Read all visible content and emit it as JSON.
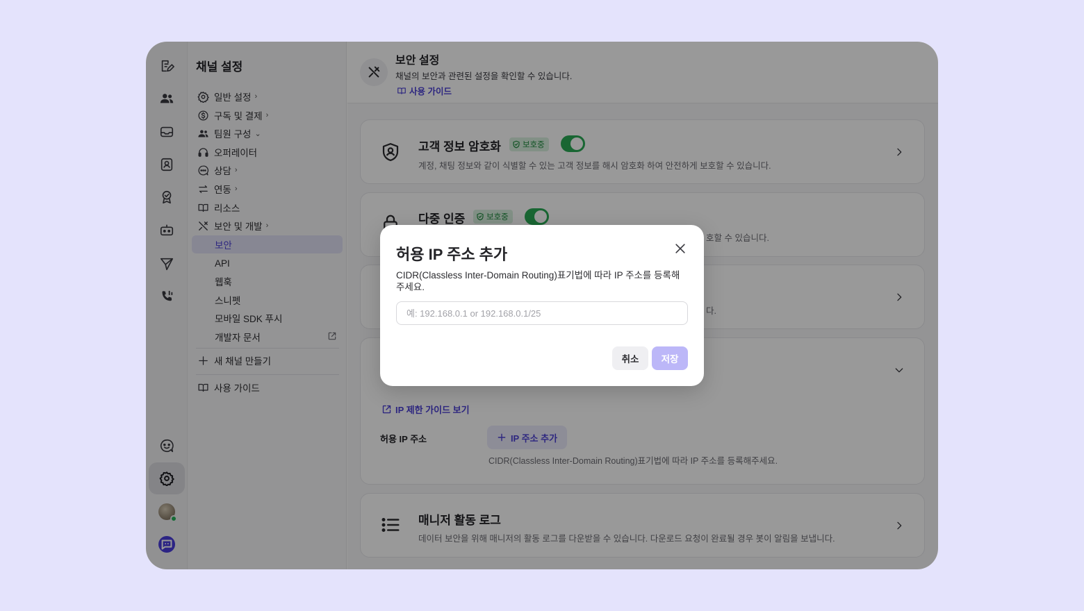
{
  "colors": {
    "accent": "#4c40d6",
    "success": "#2aaa55",
    "save_disabled": "#bcb7f8"
  },
  "rail": {
    "icons": [
      "compose-icon",
      "users-icon",
      "inbox-icon",
      "contacts-icon",
      "badge-icon",
      "bot-icon",
      "send-icon",
      "phone-icon",
      "feedback-icon",
      "gear-icon",
      "avatar",
      "brand-icon"
    ]
  },
  "sidebar": {
    "title": "채널 설정",
    "items": [
      {
        "label": "일반 설정",
        "icon": "gear-icon",
        "chevron": ">"
      },
      {
        "label": "구독 및 결제",
        "icon": "dollar-icon",
        "chevron": ">"
      },
      {
        "label": "팀원 구성",
        "icon": "team-icon",
        "chevron": "v"
      },
      {
        "label": "오퍼레이터",
        "icon": "headset-icon"
      },
      {
        "label": "상담",
        "icon": "chat-icon",
        "chevron": ">"
      },
      {
        "label": "연동",
        "icon": "swap-icon",
        "chevron": ">"
      },
      {
        "label": "리소스",
        "icon": "book-icon"
      },
      {
        "label": "보안 및 개발",
        "icon": "tools-icon",
        "chevron": ">"
      }
    ],
    "sub_items": [
      "보안",
      "API",
      "웹훅",
      "스니펫",
      "모바일 SDK 푸시",
      "개발자 문서"
    ],
    "new_channel": "새 채널 만들기",
    "guide": "사용 가이드"
  },
  "header": {
    "title": "보안 설정",
    "description": "채널의 보안과 관련된 설정을 확인할 수 있습니다.",
    "guide_link": "사용 가이드"
  },
  "cards": {
    "encryption": {
      "title": "고객 정보 암호화",
      "badge": "보호중",
      "toggle_on": true,
      "description": "계정, 채팅 정보와 같이 식별할 수 있는 고객 정보를 해시 암호화 하여 안전하게 보호할 수 있습니다."
    },
    "mfa": {
      "title": "다중 인증",
      "badge": "보호중",
      "toggle_on": true,
      "description_tail": "호할 수 있습니다."
    },
    "card3": {
      "description_tail": "다."
    },
    "ip": {
      "guide_link": "IP 제한 가이드 보기",
      "label": "허용 IP 주소",
      "add_button": "IP 주소 추가",
      "help": "CIDR(Classless Inter-Domain Routing)표기법에 따라 IP 주소를 등록해주세요."
    },
    "activity": {
      "title": "매니저 활동 로그",
      "description": "데이터 보안을 위해 매니저의 활동 로그를 다운받을 수 있습니다. 다운로드 요청이 완료될 경우 봇이 알림을 보냅니다."
    }
  },
  "modal": {
    "title": "허용 IP 주소 추가",
    "description": "CIDR(Classless Inter-Domain Routing)표기법에 따라 IP 주소를 등록해주세요.",
    "input_value": "",
    "input_placeholder": "예: 192.168.0.1 or 192.168.0.1/25",
    "cancel": "취소",
    "save": "저장"
  }
}
